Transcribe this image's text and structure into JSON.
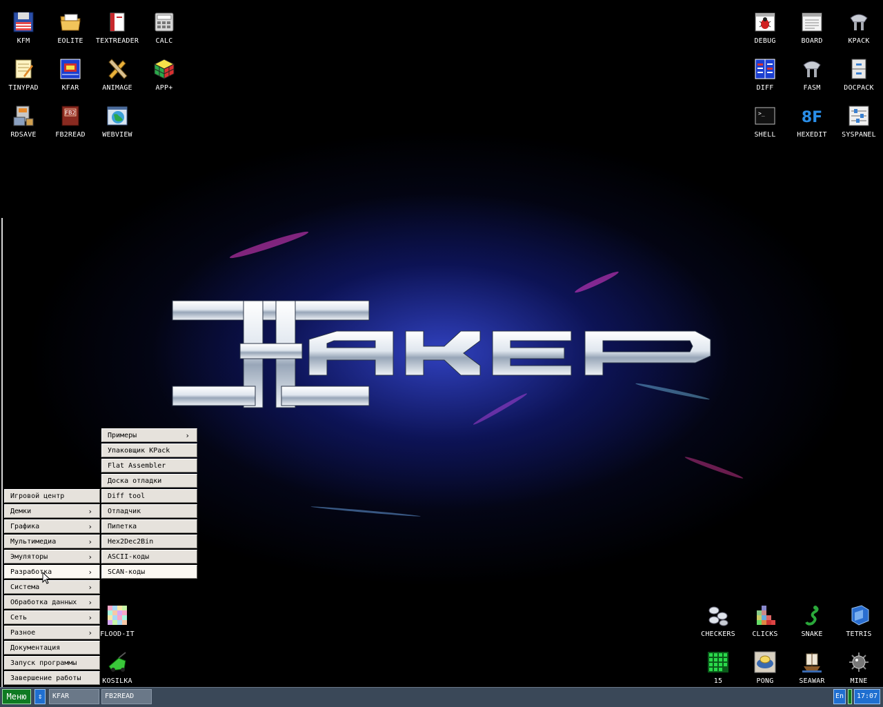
{
  "desktop": {
    "icons_left": [
      {
        "label": "KFM",
        "icon": "floppy-disk-icon"
      },
      {
        "label": "EOLITE",
        "icon": "folder-icon"
      },
      {
        "label": "TEXTREADER",
        "icon": "book-icon"
      },
      {
        "label": "CALC",
        "icon": "calculator-icon"
      },
      {
        "label": "TINYPAD",
        "icon": "notepad-icon"
      },
      {
        "label": "KFAR",
        "icon": "archive-window-icon"
      },
      {
        "label": "ANIMAGE",
        "icon": "pencil-brush-icon"
      },
      {
        "label": "APP+",
        "icon": "rubik-cube-icon"
      },
      {
        "label": "RDSAVE",
        "icon": "disk-save-icon"
      },
      {
        "label": "FB2READ",
        "icon": "fb2-book-icon"
      },
      {
        "label": "WEBVIEW",
        "icon": "globe-window-icon"
      }
    ],
    "icons_right": [
      {
        "label": "DEBUG",
        "icon": "bug-window-icon"
      },
      {
        "label": "BOARD",
        "icon": "board-window-icon"
      },
      {
        "label": "KPACK",
        "icon": "kpack-icon"
      },
      {
        "label": "DIFF",
        "icon": "diff-icon"
      },
      {
        "label": "FASM",
        "icon": "fasm-icon"
      },
      {
        "label": "DOCPACK",
        "icon": "cabinet-icon"
      },
      {
        "label": "SHELL",
        "icon": "terminal-icon"
      },
      {
        "label": "HEXEDIT",
        "icon": "hex-8f-icon"
      },
      {
        "label": "SYSPANEL",
        "icon": "sliders-icon"
      }
    ],
    "icons_games": [
      {
        "label": "CHECKERS",
        "icon": "checkers-icon"
      },
      {
        "label": "CLICKS",
        "icon": "clicks-blocks-icon"
      },
      {
        "label": "SNAKE",
        "icon": "snake-icon"
      },
      {
        "label": "TETRIS",
        "icon": "tetris-icon"
      },
      {
        "label": "15",
        "icon": "fifteen-grid-icon"
      },
      {
        "label": "PONG",
        "icon": "pong-icon"
      },
      {
        "label": "SEAWAR",
        "icon": "ship-icon"
      },
      {
        "label": "MINE",
        "icon": "mine-icon"
      }
    ],
    "icons_extra": [
      {
        "label": "FLOOD-IT",
        "icon": "flood-it-icon"
      },
      {
        "label": "KOSILKA",
        "icon": "lawnmower-icon"
      }
    ]
  },
  "main_menu": {
    "items": [
      {
        "label": "Игровой центр",
        "submenu": false
      },
      {
        "label": "Демки",
        "submenu": true
      },
      {
        "label": "Графика",
        "submenu": true
      },
      {
        "label": "Мультимедиа",
        "submenu": true
      },
      {
        "label": "Эмуляторы",
        "submenu": true
      },
      {
        "label": "Разработка",
        "submenu": true,
        "active": true
      },
      {
        "label": "Система",
        "submenu": true
      },
      {
        "label": "Обработка данных",
        "submenu": true
      },
      {
        "label": "Сеть",
        "submenu": true
      },
      {
        "label": "Разное",
        "submenu": true
      },
      {
        "label": "Документация",
        "submenu": false
      },
      {
        "label": "Запуск программы",
        "submenu": false
      },
      {
        "label": "Завершение работы",
        "submenu": false
      }
    ]
  },
  "sub_menu": {
    "items": [
      {
        "label": "Примеры",
        "submenu": true
      },
      {
        "label": "Упаковщик KPack",
        "submenu": false
      },
      {
        "label": "Flat Assembler",
        "submenu": false
      },
      {
        "label": "Доска отладки",
        "submenu": false
      },
      {
        "label": "Diff tool",
        "submenu": false
      },
      {
        "label": "Отладчик",
        "submenu": false
      },
      {
        "label": "Пипетка",
        "submenu": false
      },
      {
        "label": "Hex2Dec2Bin",
        "submenu": false
      },
      {
        "label": "ASCII-коды",
        "submenu": false
      },
      {
        "label": "SCAN-коды",
        "submenu": false,
        "active": true
      }
    ]
  },
  "taskbar": {
    "menu_label": "Меню",
    "switch_glyph": "⇕",
    "tasks": [
      "KFAR",
      "FB2READ"
    ],
    "lang": "En",
    "clock": "17:07"
  },
  "colors": {
    "menu_bg": "#e6e2dc",
    "taskbar_bg": "#3a4858",
    "accent_green": "#0e7a22",
    "accent_blue": "#1f6fd0"
  }
}
